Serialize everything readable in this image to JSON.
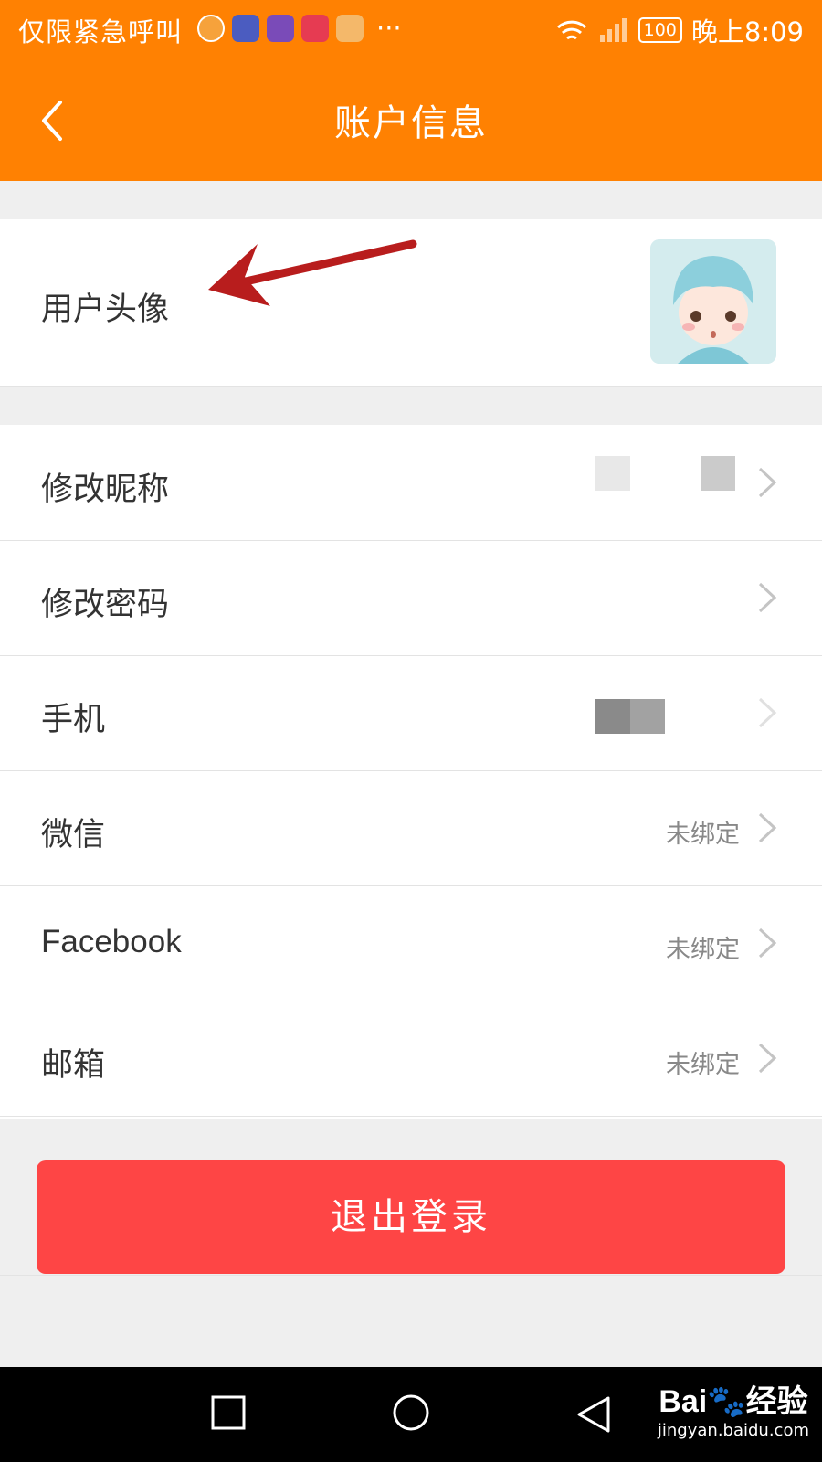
{
  "status_bar": {
    "carrier": "仅限紧急呼叫",
    "battery": "100",
    "time": "晚上8:09",
    "more": "···"
  },
  "header": {
    "title": "账户信息"
  },
  "avatar_row": {
    "label": "用户头像"
  },
  "rows": [
    {
      "label": "修改昵称",
      "value": ""
    },
    {
      "label": "修改密码",
      "value": ""
    },
    {
      "label": "手机",
      "value": ""
    },
    {
      "label": "微信",
      "value": "未绑定"
    },
    {
      "label": "Facebook",
      "value": "未绑定"
    },
    {
      "label": "邮箱",
      "value": "未绑定"
    }
  ],
  "logout_button": "退出登录",
  "watermark": {
    "brand": "Bai",
    "brand_cn": "经验",
    "url": "jingyan.baidu.com"
  },
  "colors": {
    "accent": "#ff8102",
    "logout": "#fe4545"
  }
}
